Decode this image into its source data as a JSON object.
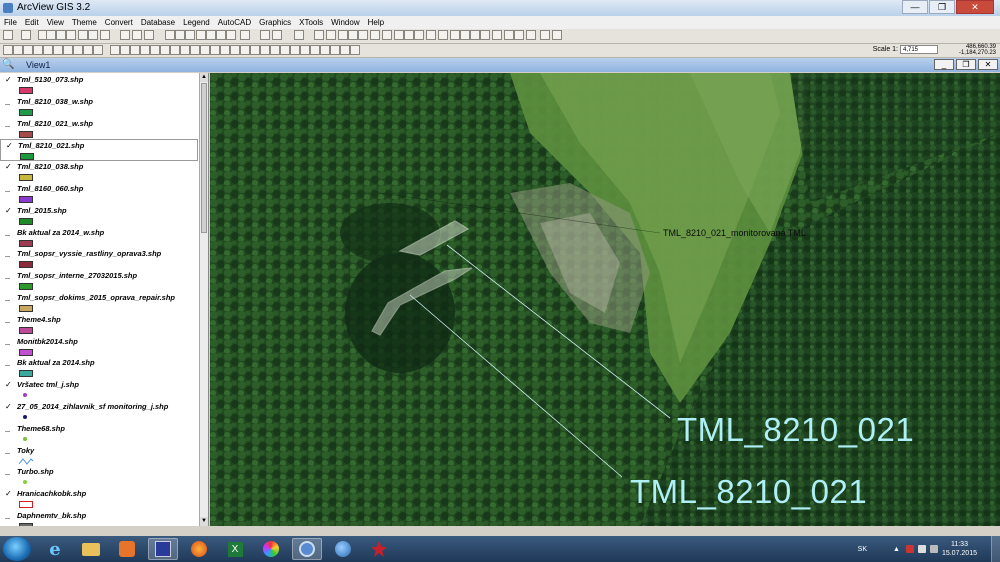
{
  "window": {
    "title": "ArcView GIS 3.2",
    "min": "—",
    "max": "❐",
    "close": "✕"
  },
  "menu": [
    "File",
    "Edit",
    "View",
    "Theme",
    "Convert",
    "Database",
    "Legend",
    "AutoCAD",
    "Graphics",
    "XTools",
    "Window",
    "Help"
  ],
  "toolbar": {
    "scale_label": "Scale 1:",
    "scale_value": "4,715",
    "coord_x": "486,660.39",
    "coord_y": "-1,184,270.23"
  },
  "view": {
    "title": "View1"
  },
  "layers": [
    {
      "name": "Tml_5130_073.shp",
      "checked": true,
      "symbol": "fill",
      "color": "#d43a6a"
    },
    {
      "name": "Tml_8210_038_w.shp",
      "checked": false,
      "symbol": "fill",
      "color": "#1f9a4a"
    },
    {
      "name": "Tml_8210_021_w.shp",
      "checked": false,
      "symbol": "fill",
      "color": "#a54a4a"
    },
    {
      "name": "Tml_8210_021.shp",
      "checked": true,
      "symbol": "fill",
      "color": "#1a9a3a",
      "selected": true
    },
    {
      "name": "Tml_8210_038.shp",
      "checked": true,
      "symbol": "fill",
      "color": "#c8b840"
    },
    {
      "name": "Tml_8160_060.shp",
      "checked": false,
      "symbol": "fill",
      "color": "#8a3ad0"
    },
    {
      "name": "Tml_2015.shp",
      "checked": true,
      "symbol": "fill",
      "color": "#1e8a2a"
    },
    {
      "name": "Bk aktual za 2014_w.shp",
      "checked": false,
      "symbol": "fill",
      "color": "#9c3a52"
    },
    {
      "name": "Tml_sopsr_vyssie_rastliny_oprava3.shp",
      "checked": false,
      "symbol": "fill",
      "color": "#8a2a3a"
    },
    {
      "name": "Tml_sopsr_interne_27032015.shp",
      "checked": false,
      "symbol": "fill",
      "color": "#2a9a2a"
    },
    {
      "name": "Tml_sopsr_dokims_2015_oprava_repair.shp",
      "checked": false,
      "symbol": "fill",
      "color": "#c8a860"
    },
    {
      "name": "Theme4.shp",
      "checked": false,
      "symbol": "fill",
      "color": "#c04a9a"
    },
    {
      "name": "Monitbk2014.shp",
      "checked": false,
      "symbol": "fill",
      "color": "#c050d0"
    },
    {
      "name": "Bk aktual za 2014.shp",
      "checked": false,
      "symbol": "fill",
      "color": "#3aa89a"
    },
    {
      "name": "Vršatec tml_j.shp",
      "checked": true,
      "symbol": "dot",
      "color": "#a040c0"
    },
    {
      "name": "27_05_2014_zihlavnik_sf monitoring_j.shp",
      "checked": true,
      "symbol": "dot",
      "color": "#1a1a6a"
    },
    {
      "name": "Theme68.shp",
      "checked": false,
      "symbol": "dot",
      "color": "#7ac03a"
    },
    {
      "name": "Toky",
      "checked": false,
      "symbol": "line",
      "color": "#4a90e0"
    },
    {
      "name": "Turbo.shp",
      "checked": false,
      "symbol": "dot",
      "color": "#8ad03a"
    },
    {
      "name": "Hranicachkobk.shp",
      "checked": true,
      "symbol": "outline",
      "color": "#d02020"
    },
    {
      "name": "Daphnemtv_bk.shp",
      "checked": false,
      "symbol": "fill",
      "color": "#6a6a6a"
    }
  ],
  "map": {
    "label_small": "TML_8210_021_monitorovaná TML",
    "label_big_1": "TML_8210_021",
    "label_big_2": "TML_8210_021",
    "label_color": "#aef0f5"
  },
  "taskbar": {
    "apps": [
      "start-orb",
      "internet-explorer-icon",
      "file-explorer-icon",
      "media-player-icon",
      "floppy-icon",
      "firefox-icon",
      "excel-icon",
      "picasa-icon",
      "arcview-icon",
      "google-earth-icon",
      "red-app-icon"
    ],
    "lang": "SK",
    "time": "11:33",
    "date": "15.07.2015"
  }
}
